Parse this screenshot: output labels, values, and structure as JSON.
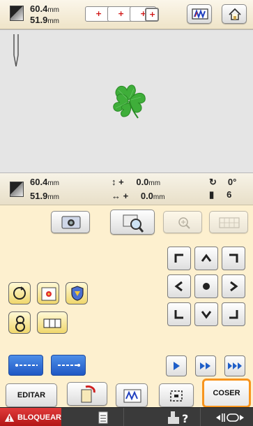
{
  "header": {
    "size_w_value": "60.4",
    "size_h_value": "51.9",
    "unit": "mm",
    "hoop_sizes": [
      "+",
      "+",
      "+",
      "+"
    ]
  },
  "preview": {
    "design_color": "#3fae3a"
  },
  "info": {
    "size_w_value": "60.4",
    "size_h_value": "51.9",
    "unit": "mm",
    "offset_v_sign": "+",
    "offset_h_sign": "+",
    "offset_v_value": "0.0",
    "offset_h_value": "0.0",
    "angle_value": "0°",
    "thread_count": "6"
  },
  "controls": {
    "edit_label": "EDITAR",
    "sew_label": "COSER",
    "lock_label": "BLOQUEAR"
  },
  "colors": {
    "accent_orange": "#f7941d",
    "lock_red": "#d61f1f",
    "blue_button": "#2e6ed6"
  }
}
